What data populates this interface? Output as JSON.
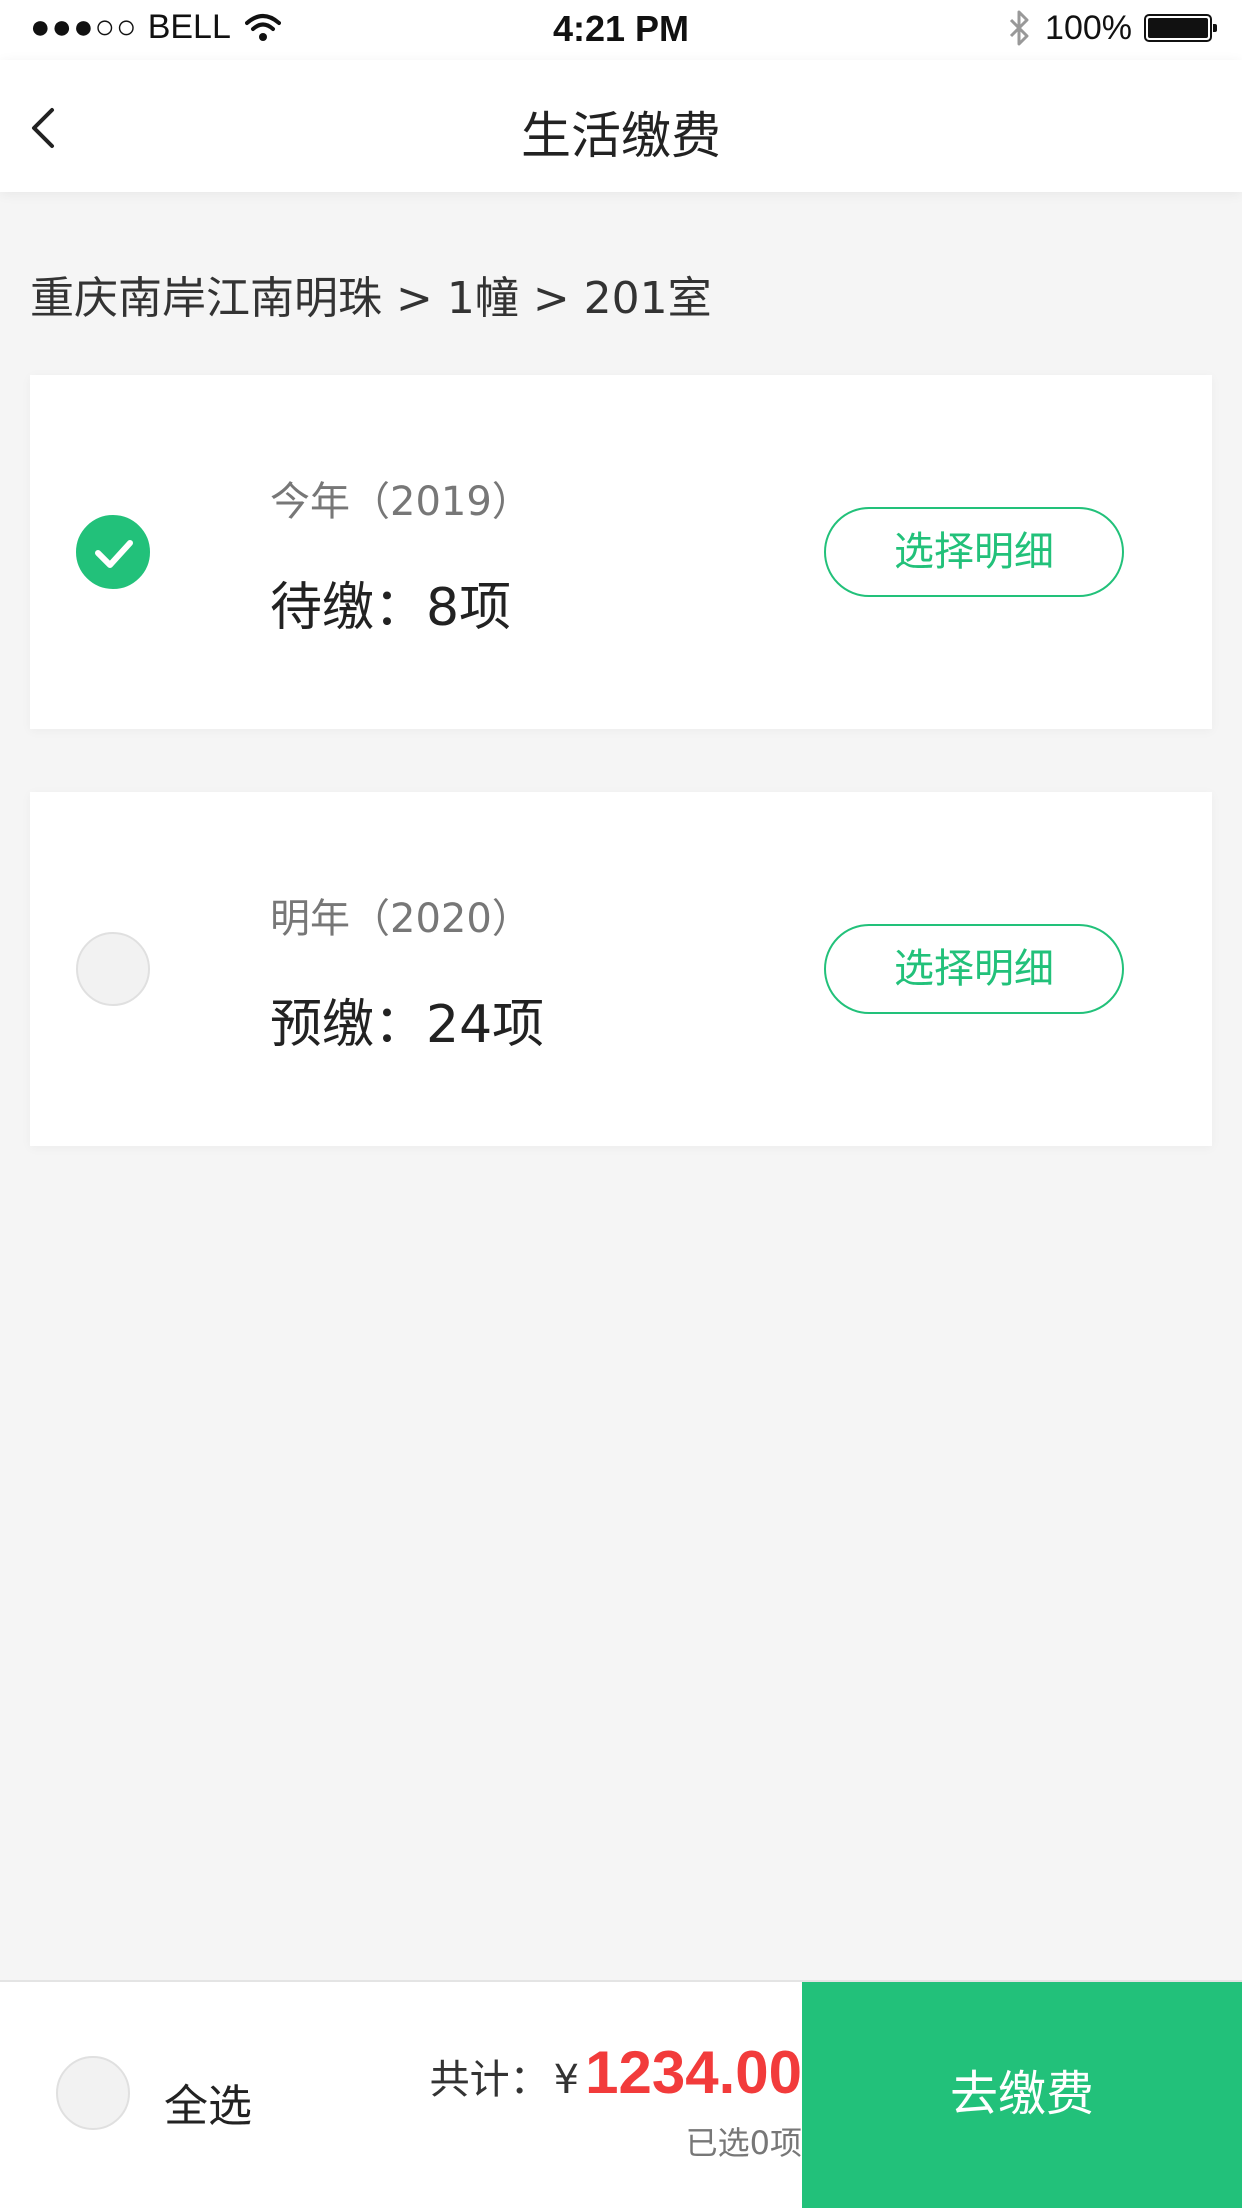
{
  "status_bar": {
    "signal": "●●●○○",
    "carrier": "BELL",
    "time": "4:21 PM",
    "battery": "100%"
  },
  "nav": {
    "title": "生活缴费"
  },
  "breadcrumb": "重庆南岸江南明珠 > 1幢 > 201室",
  "cards": [
    {
      "year_label": "今年（2019）",
      "count_label": "待缴：8项",
      "detail_button": "选择明细",
      "checked": true
    },
    {
      "year_label": "明年（2020）",
      "count_label": "预缴：24项",
      "detail_button": "选择明细",
      "checked": false
    }
  ],
  "footer": {
    "select_all_label": "全选",
    "total_label": "共计：",
    "currency": "¥",
    "total_amount": "1234.00",
    "selected_count": "已选0项",
    "pay_button": "去缴费"
  },
  "colors": {
    "accent": "#22c17a",
    "price": "#f23b3b"
  }
}
